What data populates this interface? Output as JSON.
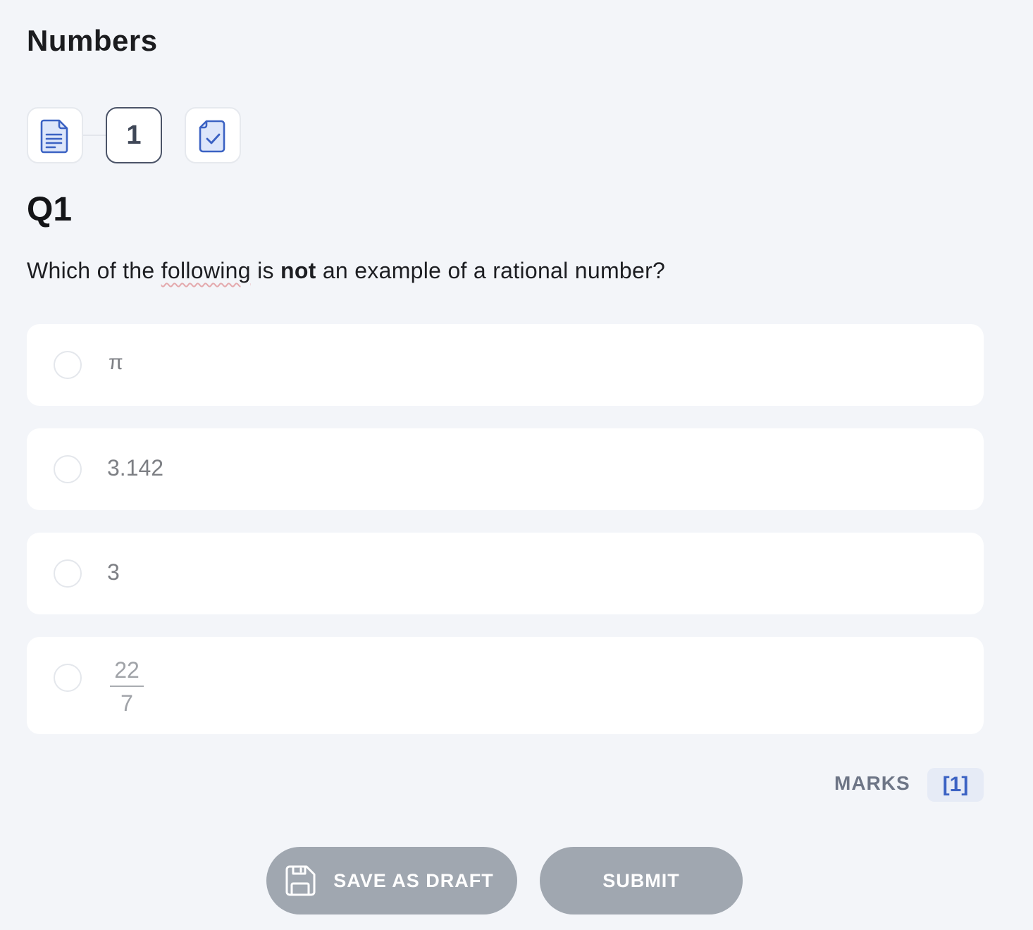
{
  "page_title": "Numbers",
  "stepper": {
    "steps": [
      {
        "icon": "document-icon"
      },
      {
        "label": "1",
        "active": true
      },
      {
        "icon": "clipboard-check-icon"
      }
    ]
  },
  "question": {
    "label": "Q1",
    "text_before": "Which of the ",
    "text_squiggle": "following",
    "text_mid": " is ",
    "text_bold": "not",
    "text_after": " an example of a rational number?"
  },
  "options": [
    {
      "text": "π"
    },
    {
      "text": "3.142"
    },
    {
      "text": "3"
    },
    {
      "numerator": "22",
      "denominator": "7"
    }
  ],
  "marks": {
    "label": "MARKS",
    "value": "[1]"
  },
  "buttons": {
    "save_draft": "SAVE AS DRAFT",
    "submit": "SUBMIT"
  },
  "colors": {
    "background": "#f3f5f9",
    "icon_blue": "#3b62c3",
    "button_disabled": "#a0a7b0"
  }
}
